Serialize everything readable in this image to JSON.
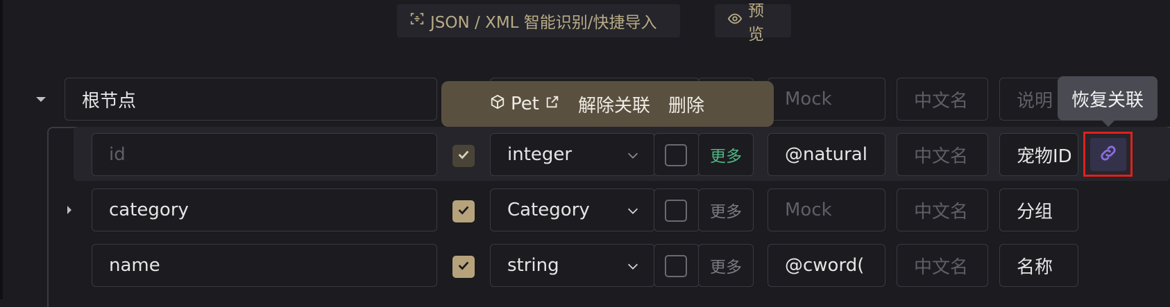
{
  "toolbar": {
    "import_label": "JSON / XML 智能识别/快捷导入",
    "preview_label": "预览"
  },
  "root": {
    "name": "根节点",
    "mock_placeholder": "Mock",
    "cn_placeholder": "中文名",
    "desc_placeholder": "说明"
  },
  "popover": {
    "ref_name": "Pet",
    "unlink_label": "解除关联",
    "delete_label": "删除"
  },
  "tooltip": {
    "text": "恢复关联"
  },
  "rows": [
    {
      "name": "",
      "name_placeholder": "id",
      "required": true,
      "type": "integer",
      "nullable": false,
      "more": "更多",
      "mock": "@natural",
      "mock_placeholder": "Mock",
      "cn_placeholder": "中文名",
      "desc": "宠物ID"
    },
    {
      "name": "category",
      "name_placeholder": "",
      "required": true,
      "type": "Category",
      "nullable": false,
      "more": "更多",
      "mock": "",
      "mock_placeholder": "Mock",
      "cn_placeholder": "中文名",
      "desc": "分组"
    },
    {
      "name": "name",
      "name_placeholder": "",
      "required": true,
      "type": "string",
      "nullable": false,
      "more": "更多",
      "mock": "@cword(",
      "mock_placeholder": "Mock",
      "cn_placeholder": "中文名",
      "desc": "名称"
    }
  ],
  "colors": {
    "accent": "#b7a37b",
    "popover_bg": "#5a5040",
    "highlight_border": "#e0201c",
    "more_active": "#4fb682",
    "link_icon": "#8a6fe0"
  },
  "icons": {
    "scan": "scan-icon",
    "eye": "eye-icon",
    "cube": "cube-icon",
    "external": "external-link-icon",
    "link": "link-icon",
    "chevron": "chevron-down-icon",
    "check": "check-icon"
  }
}
